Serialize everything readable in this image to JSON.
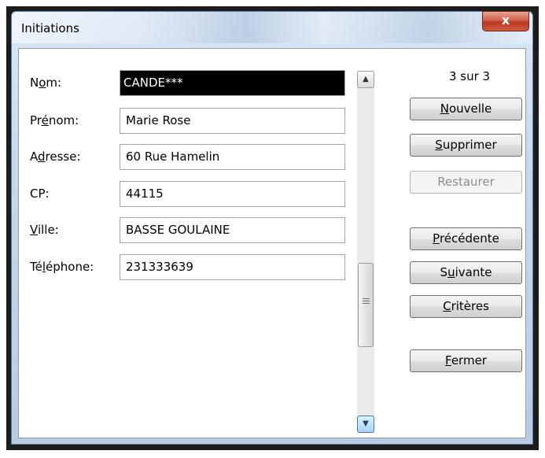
{
  "window": {
    "title": "Initiations",
    "close_glyph": "x"
  },
  "fields": [
    {
      "label_pre": "N",
      "label_key": "o",
      "label_post": "m:",
      "value": "CANDE***",
      "selected": true
    },
    {
      "label_pre": "Pr",
      "label_key": "é",
      "label_post": "nom:",
      "value": "Marie Rose"
    },
    {
      "label_pre": "A",
      "label_key": "d",
      "label_post": "resse:",
      "value": "60 Rue Hamelin"
    },
    {
      "label_pre": "CP:",
      "label_key": "",
      "label_post": "",
      "value": "44115"
    },
    {
      "label_pre": "",
      "label_key": "V",
      "label_post": "ille:",
      "value": "BASSE GOULAINE"
    },
    {
      "label_pre": "Té",
      "label_key": "l",
      "label_post": "éphone:",
      "value": "231333639"
    }
  ],
  "record_count": "3 sur 3",
  "buttons": {
    "new": {
      "key": "N",
      "rest": "ouvelle"
    },
    "delete": {
      "key": "S",
      "rest": "upprimer"
    },
    "restore": {
      "label": "Restaurer",
      "disabled": true
    },
    "previous": {
      "key": "P",
      "rest": "récédente"
    },
    "next": {
      "pre": "S",
      "key": "u",
      "rest": "ivante"
    },
    "criteria": {
      "key": "C",
      "rest": "ritères"
    },
    "close": {
      "key": "F",
      "rest": "ermer"
    }
  },
  "scrollbar": {
    "up_glyph": "▲",
    "down_glyph": "▼",
    "thumb_position": 0.67
  }
}
